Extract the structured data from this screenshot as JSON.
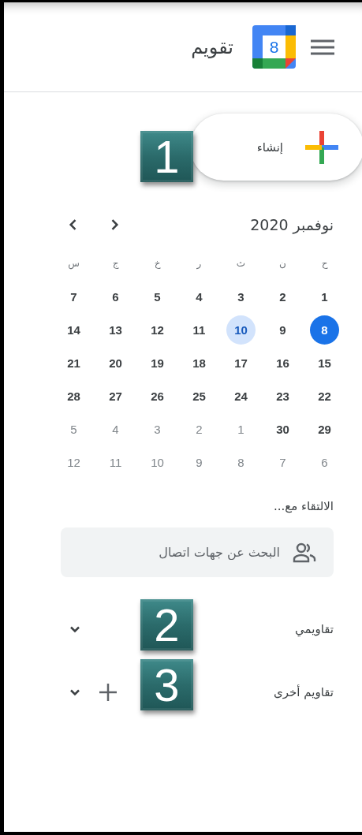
{
  "header": {
    "title": "تقويم",
    "logo_day": "8"
  },
  "create_button": {
    "label": "إنشاء",
    "marker": "1"
  },
  "mini_calendar": {
    "month": "نوفمبر 2020",
    "weekdays": [
      "ح",
      "ن",
      "ث",
      "ر",
      "خ",
      "ج",
      "س"
    ],
    "weeks": [
      [
        {
          "day": "1",
          "in_month": true,
          "today": false,
          "selected": false
        },
        {
          "day": "2",
          "in_month": true,
          "today": false,
          "selected": false
        },
        {
          "day": "3",
          "in_month": true,
          "today": false,
          "selected": false
        },
        {
          "day": "4",
          "in_month": true,
          "today": false,
          "selected": false
        },
        {
          "day": "5",
          "in_month": true,
          "today": false,
          "selected": false
        },
        {
          "day": "6",
          "in_month": true,
          "today": false,
          "selected": false
        },
        {
          "day": "7",
          "in_month": true,
          "today": false,
          "selected": false
        }
      ],
      [
        {
          "day": "8",
          "in_month": true,
          "today": true,
          "selected": false
        },
        {
          "day": "9",
          "in_month": true,
          "today": false,
          "selected": false
        },
        {
          "day": "10",
          "in_month": true,
          "today": false,
          "selected": true
        },
        {
          "day": "11",
          "in_month": true,
          "today": false,
          "selected": false
        },
        {
          "day": "12",
          "in_month": true,
          "today": false,
          "selected": false
        },
        {
          "day": "13",
          "in_month": true,
          "today": false,
          "selected": false
        },
        {
          "day": "14",
          "in_month": true,
          "today": false,
          "selected": false
        }
      ],
      [
        {
          "day": "15",
          "in_month": true,
          "today": false,
          "selected": false
        },
        {
          "day": "16",
          "in_month": true,
          "today": false,
          "selected": false
        },
        {
          "day": "17",
          "in_month": true,
          "today": false,
          "selected": false
        },
        {
          "day": "18",
          "in_month": true,
          "today": false,
          "selected": false
        },
        {
          "day": "19",
          "in_month": true,
          "today": false,
          "selected": false
        },
        {
          "day": "20",
          "in_month": true,
          "today": false,
          "selected": false
        },
        {
          "day": "21",
          "in_month": true,
          "today": false,
          "selected": false
        }
      ],
      [
        {
          "day": "22",
          "in_month": true,
          "today": false,
          "selected": false
        },
        {
          "day": "23",
          "in_month": true,
          "today": false,
          "selected": false
        },
        {
          "day": "24",
          "in_month": true,
          "today": false,
          "selected": false
        },
        {
          "day": "25",
          "in_month": true,
          "today": false,
          "selected": false
        },
        {
          "day": "26",
          "in_month": true,
          "today": false,
          "selected": false
        },
        {
          "day": "27",
          "in_month": true,
          "today": false,
          "selected": false
        },
        {
          "day": "28",
          "in_month": true,
          "today": false,
          "selected": false
        }
      ],
      [
        {
          "day": "29",
          "in_month": true,
          "today": false,
          "selected": false
        },
        {
          "day": "30",
          "in_month": true,
          "today": false,
          "selected": false
        },
        {
          "day": "1",
          "in_month": false,
          "today": false,
          "selected": false
        },
        {
          "day": "2",
          "in_month": false,
          "today": false,
          "selected": false
        },
        {
          "day": "3",
          "in_month": false,
          "today": false,
          "selected": false
        },
        {
          "day": "4",
          "in_month": false,
          "today": false,
          "selected": false
        },
        {
          "day": "5",
          "in_month": false,
          "today": false,
          "selected": false
        }
      ],
      [
        {
          "day": "6",
          "in_month": false,
          "today": false,
          "selected": false
        },
        {
          "day": "7",
          "in_month": false,
          "today": false,
          "selected": false
        },
        {
          "day": "8",
          "in_month": false,
          "today": false,
          "selected": false
        },
        {
          "day": "9",
          "in_month": false,
          "today": false,
          "selected": false
        },
        {
          "day": "10",
          "in_month": false,
          "today": false,
          "selected": false
        },
        {
          "day": "11",
          "in_month": false,
          "today": false,
          "selected": false
        },
        {
          "day": "12",
          "in_month": false,
          "today": false,
          "selected": false
        }
      ]
    ]
  },
  "meet_with": {
    "heading": "الالتقاء مع...",
    "search": {
      "placeholder": "البحث عن جهات اتصال"
    }
  },
  "calendar_sections": [
    {
      "label": "تقاويمي",
      "expanded": false,
      "can_add": false,
      "marker": "2"
    },
    {
      "label": "تقاويم أخرى",
      "expanded": false,
      "can_add": true,
      "marker": "3"
    }
  ]
}
